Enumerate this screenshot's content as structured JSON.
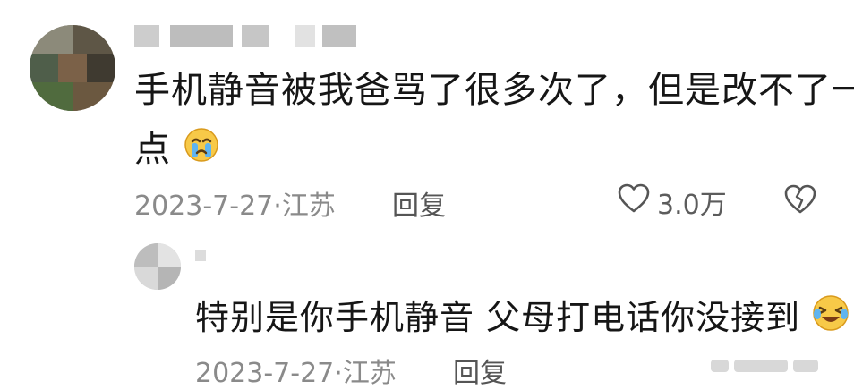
{
  "comment": {
    "line1": "手机静音被我爸骂了很多次了，但是改不了一",
    "line2": "点",
    "emoji": "crying-face-emoji",
    "date": "2023-7-27",
    "location": "江苏",
    "reply_label": "回复",
    "like_count": "3.0万"
  },
  "reply": {
    "text": "特别是你手机静音 父母打电话你没接到",
    "emoji": "laughing-tears-emoji",
    "date": "2023-7-27",
    "location": "江苏",
    "reply_label": "回复"
  },
  "icons": {
    "like": "heart-outline-icon",
    "dislike": "broken-heart-icon"
  }
}
